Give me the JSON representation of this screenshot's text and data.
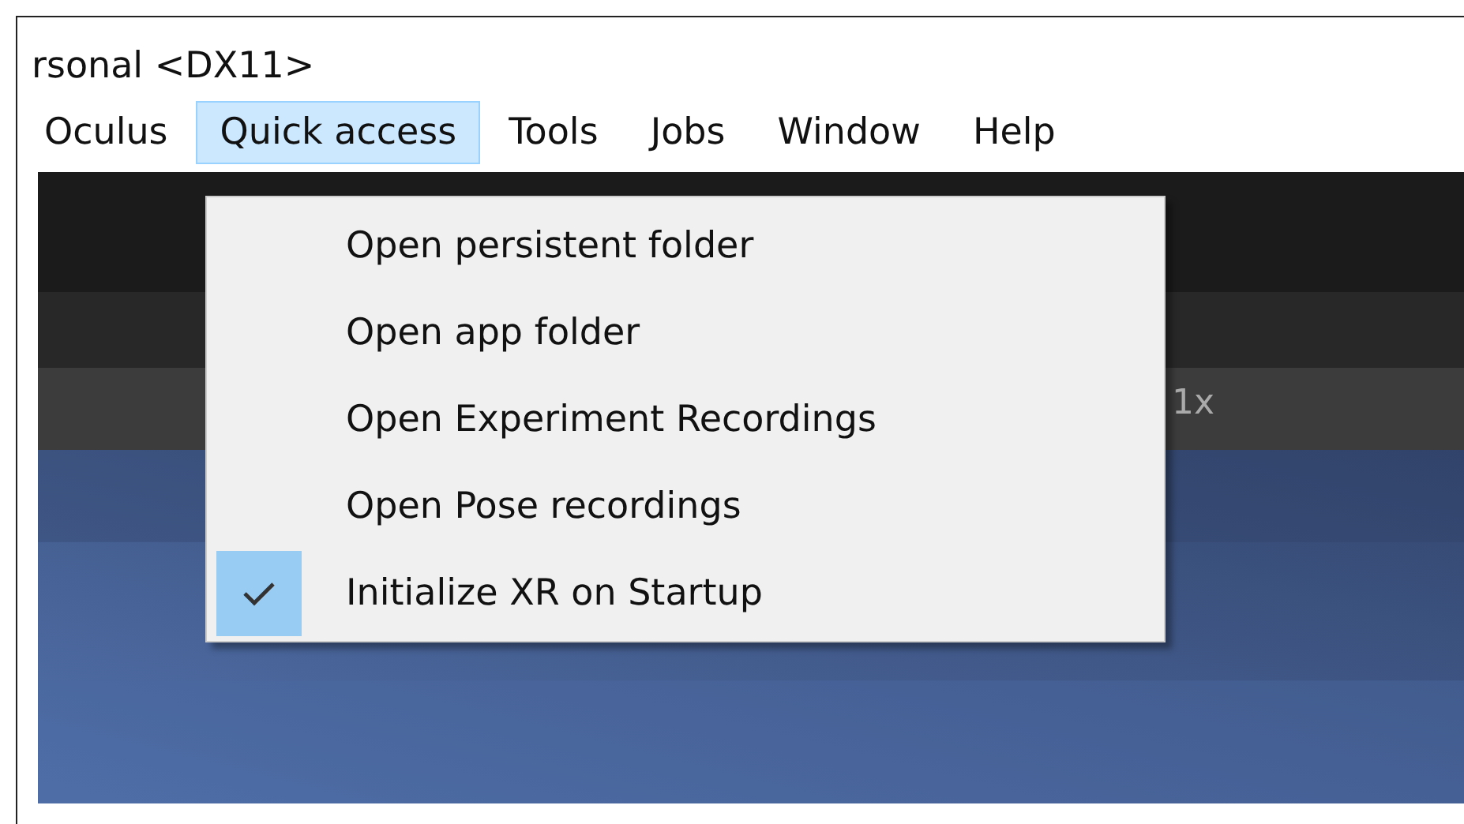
{
  "window": {
    "title": "rsonal <DX11>"
  },
  "menu_bar": [
    {
      "label": "Oculus",
      "selected": false
    },
    {
      "label": "Quick access",
      "selected": true
    },
    {
      "label": "Tools",
      "selected": false
    },
    {
      "label": "Jobs",
      "selected": false
    },
    {
      "label": "Window",
      "selected": false
    },
    {
      "label": "Help",
      "selected": false
    }
  ],
  "dropdown": [
    {
      "label": "Open persistent folder",
      "checked": false
    },
    {
      "label": "Open app folder",
      "checked": false
    },
    {
      "label": "Open Experiment Recordings",
      "checked": false
    },
    {
      "label": "Open Pose recordings",
      "checked": false
    },
    {
      "label": "Initialize XR on Startup",
      "checked": true
    }
  ],
  "toolbar": {
    "scale": "1x"
  }
}
